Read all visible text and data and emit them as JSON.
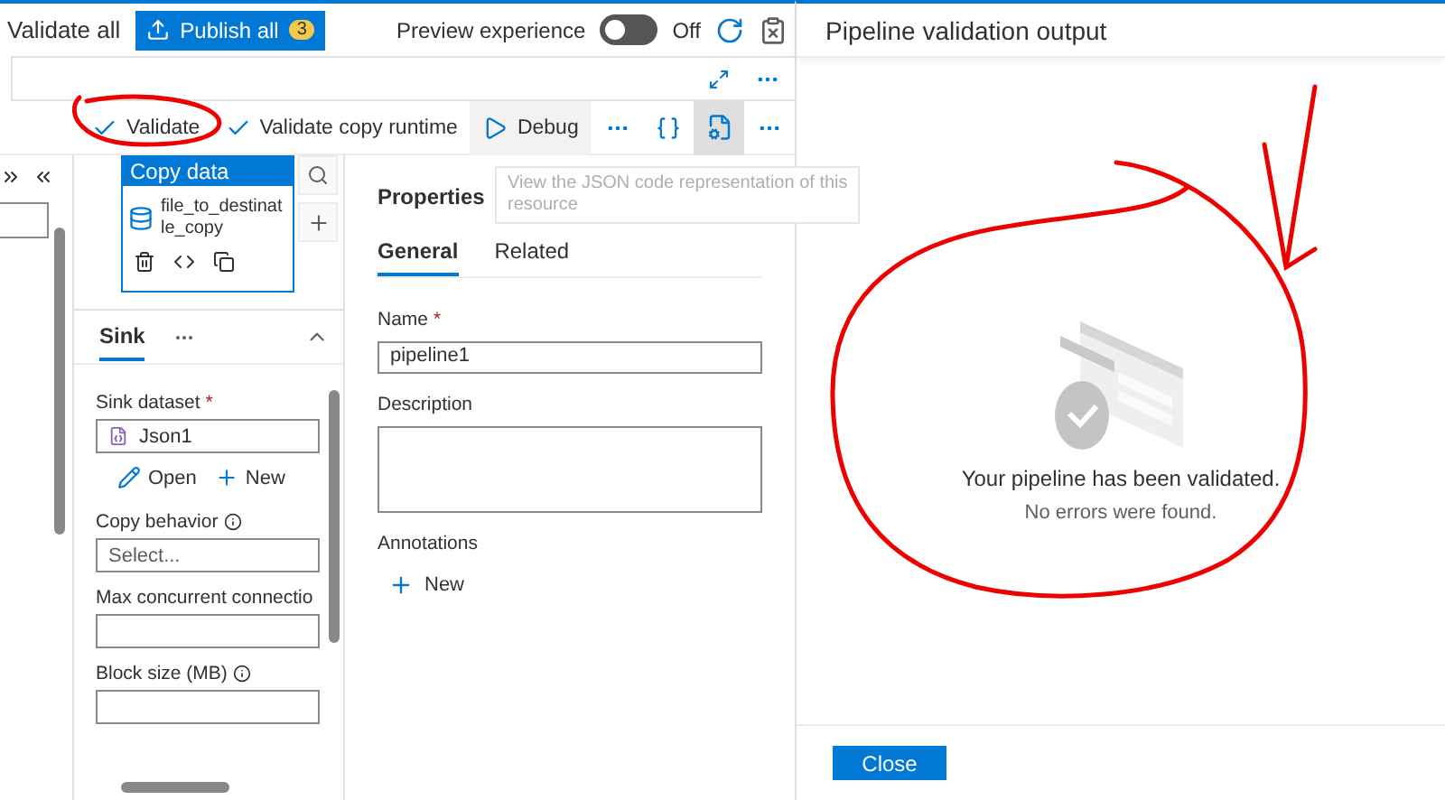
{
  "top_toolbar": {
    "validate_all": "Validate all",
    "publish": {
      "label": "Publish all",
      "badge": "3"
    },
    "preview": {
      "label": "Preview experience",
      "on": false,
      "state_label": "Off"
    }
  },
  "pipeline_toolbar": {
    "items": [
      {
        "kind": "check",
        "label": "Validate",
        "active": false
      },
      {
        "kind": "check",
        "label": "Validate copy runtime",
        "active": false
      },
      {
        "kind": "play",
        "label": "Debug",
        "active": true
      }
    ],
    "code_view_selected": true
  },
  "activity": {
    "title": "Copy data",
    "name_lines": [
      "file_to_destinat",
      "le_copy"
    ]
  },
  "sink_panel": {
    "tabs": [
      {
        "label": "Sink",
        "selected": true
      }
    ],
    "fields": [
      {
        "kind": "dataset",
        "label": "Sink dataset",
        "required_mark": "*",
        "value": "Json1"
      },
      {
        "kind": "actions",
        "actions": [
          {
            "kind": "open",
            "label": "Open"
          },
          {
            "kind": "new",
            "label": "New"
          }
        ]
      },
      {
        "kind": "select",
        "label": "Copy behavior",
        "info": true,
        "placeholder": "Select..."
      },
      {
        "kind": "text",
        "label": "Max concurrent connectio",
        "info": false
      },
      {
        "kind": "text",
        "label": "Block size (MB)",
        "info": true
      }
    ]
  },
  "properties": {
    "title": "Properties",
    "tabs": [
      {
        "label": "General",
        "selected": true
      },
      {
        "label": "Related",
        "selected": false
      }
    ],
    "name": {
      "label": "Name",
      "required_mark": "*",
      "value": "pipeline1"
    },
    "description": {
      "label": "Description"
    },
    "annotations": {
      "label": "Annotations",
      "add": "New"
    }
  },
  "tooltip": {
    "lines": [
      "View the JSON code representation of this",
      "resource"
    ]
  },
  "validation_panel": {
    "title": "Pipeline validation output",
    "message": "Your pipeline has been validated.",
    "detail": "No errors were found.",
    "close": "Close"
  }
}
